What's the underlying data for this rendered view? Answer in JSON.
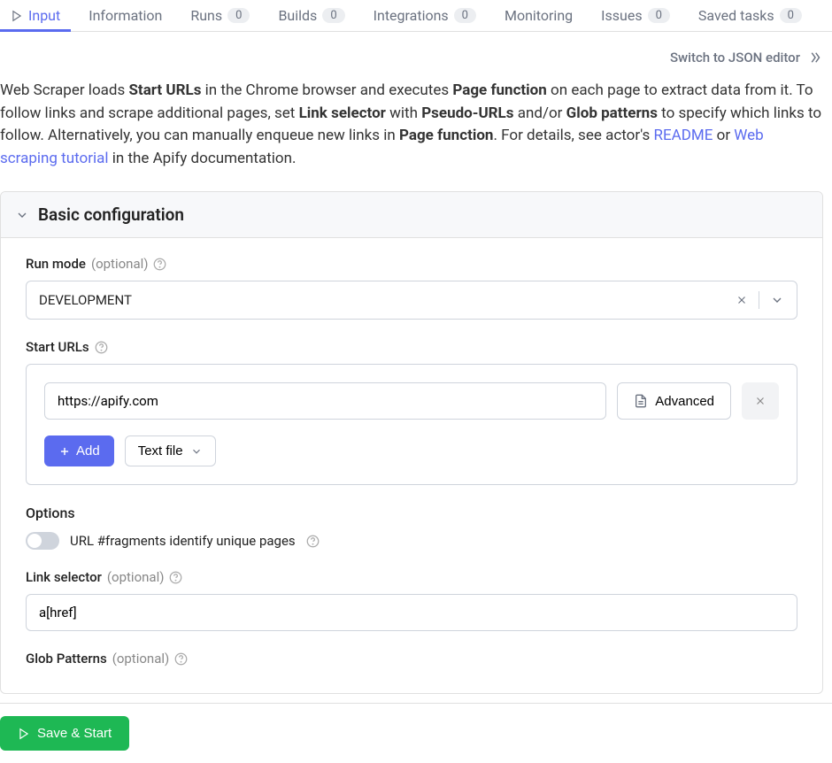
{
  "tabs": [
    {
      "label": "Input",
      "active": true,
      "icon": true
    },
    {
      "label": "Information",
      "badge": null
    },
    {
      "label": "Runs",
      "badge": "0"
    },
    {
      "label": "Builds",
      "badge": "0"
    },
    {
      "label": "Integrations",
      "badge": "0"
    },
    {
      "label": "Monitoring",
      "badge": null
    },
    {
      "label": "Issues",
      "badge": "0"
    },
    {
      "label": "Saved tasks",
      "badge": "0"
    }
  ],
  "json_switch": "Switch to JSON editor",
  "intro": {
    "t1": "Web Scraper loads ",
    "b1": "Start URLs",
    "t2": " in the Chrome browser and executes ",
    "b2": "Page function",
    "t3": " on each page to extract data from it. To follow links and scrape additional pages, set ",
    "b3": "Link selector",
    "t4": " with ",
    "b4": "Pseudo-URLs",
    "t5": " and/or ",
    "b5": "Glob patterns",
    "t6": " to specify which links to follow. Alternatively, you can manually enqueue new links in ",
    "b6": "Page function",
    "t7": ". For details, see actor's ",
    "link1": "README",
    "t8": " or ",
    "link2": "Web scraping tutorial",
    "t9": " in the Apify documentation."
  },
  "section_title": "Basic configuration",
  "run_mode": {
    "label": "Run mode",
    "optional": "(optional)",
    "value": "DEVELOPMENT"
  },
  "start_urls": {
    "label": "Start URLs",
    "value": "https://apify.com",
    "advanced": "Advanced",
    "add": "Add",
    "text_file": "Text file"
  },
  "options": {
    "title": "Options",
    "fragments": "URL #fragments identify unique pages"
  },
  "link_selector": {
    "label": "Link selector",
    "optional": "(optional)",
    "value": "a[href]"
  },
  "glob_patterns": {
    "label": "Glob Patterns",
    "optional": "(optional)"
  },
  "save_button": "Save & Start"
}
